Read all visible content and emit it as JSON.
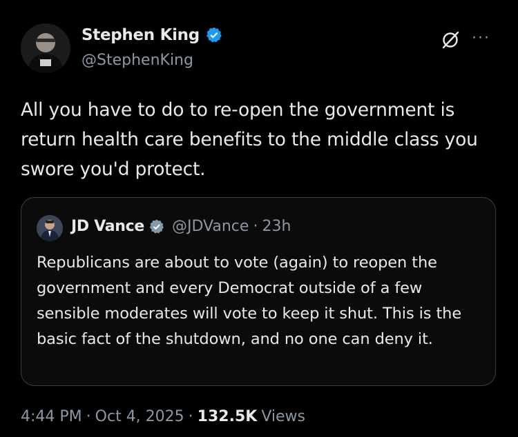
{
  "author": {
    "display_name": "Stephen King",
    "handle": "@StephenKing"
  },
  "tweet": {
    "text": "All you have to do to re-open the government is return health care benefits to the middle class you swore you'd protect."
  },
  "quoted": {
    "display_name": "JD Vance",
    "handle": "@JDVance",
    "separator": "·",
    "time": "23h",
    "text": "Republicans are about to vote (again) to reopen the government and every Democrat outside of a few sensible moderates will vote to keep it shut. This is the basic fact of the shutdown, and no one can deny it."
  },
  "meta": {
    "time": "4:44 PM",
    "sep1": "·",
    "date": "Oct 4, 2025",
    "sep2": "·",
    "views_count": "132.5K",
    "views_label": "Views"
  },
  "icons": {
    "verified": "verified-badge-icon",
    "grok": "grok-icon",
    "more": "more-icon"
  },
  "colors": {
    "background": "#000000",
    "text": "#e7e9ea",
    "secondary": "#8b98a5",
    "verified_blue": "#1d9bf0",
    "border": "#3a3d41"
  }
}
